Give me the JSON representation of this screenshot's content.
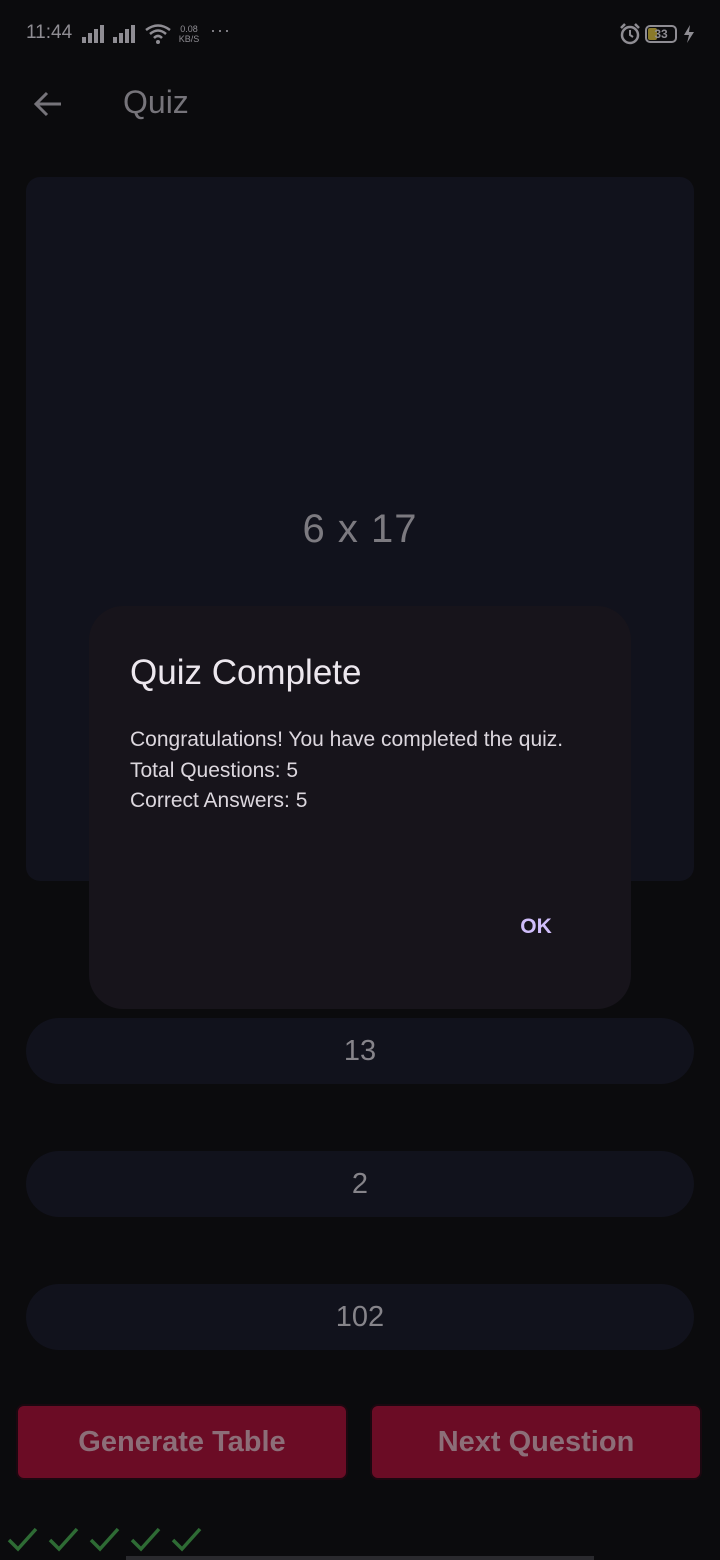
{
  "status_bar": {
    "time": "11:44",
    "net_speed_value": "0.08",
    "net_speed_unit": "KB/S",
    "more": "···",
    "battery_level": "33"
  },
  "app_bar": {
    "title": "Quiz"
  },
  "quiz": {
    "question": "6 x 17",
    "answers": [
      "13",
      "2",
      "102"
    ]
  },
  "buttons": {
    "generate_table": "Generate Table",
    "next_question": "Next Question"
  },
  "progress": {
    "correct_count": 5
  },
  "dialog": {
    "title": "Quiz Complete",
    "line1": "Congratulations! You have completed the quiz.",
    "line2": "Total Questions: 5",
    "line3": "Correct Answers: 5",
    "ok_label": "OK"
  },
  "colors": {
    "accent_button": "#6b0c25",
    "check": "#2e6b34",
    "dialog_action": "#cfbdfa"
  }
}
